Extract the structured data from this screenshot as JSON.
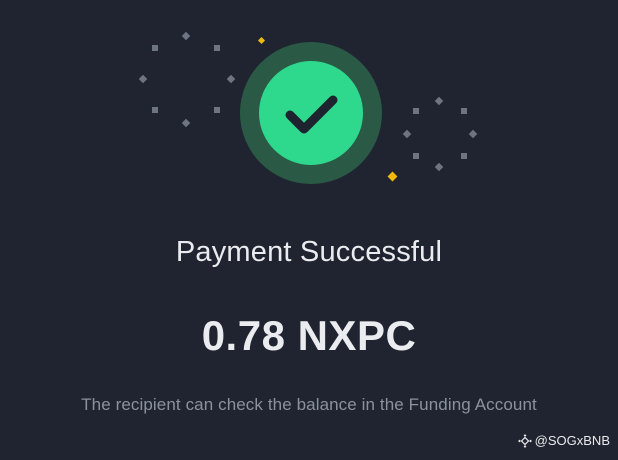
{
  "status": {
    "title": "Payment Successful",
    "amount": "0.78 NXPC",
    "message": "The recipient can check the balance in the Funding Account"
  },
  "icon": {
    "name": "check-circle-icon",
    "accent_color": "#2ed98e",
    "ring_color": "#2a5a46",
    "check_color": "#1e2330",
    "sparkle_gray": "#6e7480",
    "sparkle_gold": "#f0b90b"
  },
  "watermark": {
    "handle": "@SOGxBNB"
  }
}
